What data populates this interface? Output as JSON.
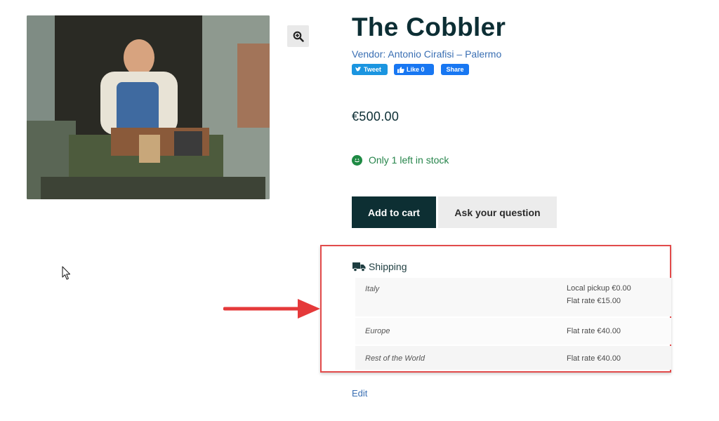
{
  "product": {
    "title": "The Cobbler",
    "vendor": "Vendor: Antonio Cirafisi – Palermo",
    "price": "€500.00",
    "stock": "Only 1 left in stock",
    "image_icon": "cobbler-painting"
  },
  "social": {
    "tweet_label": "Tweet",
    "like_label": "Like 0",
    "share_label": "Share"
  },
  "actions": {
    "add_to_cart": "Add to cart",
    "ask_question": "Ask your question"
  },
  "shipping": {
    "header": "Shipping",
    "rows": [
      {
        "region": "Italy",
        "methods": [
          "Local pickup €0.00",
          "Flat rate €15.00"
        ]
      },
      {
        "region": "Europe",
        "methods": [
          "Flat rate €40.00"
        ]
      },
      {
        "region": "Rest of the World",
        "methods": [
          "Flat rate €40.00"
        ]
      }
    ]
  },
  "edit_label": "Edit",
  "colors": {
    "title": "#0c2e34",
    "link": "#3a6fb3",
    "stock": "#25844a",
    "primary_button": "#0d2f33",
    "highlight_border": "#e24b4b",
    "annotation_arrow": "#e5393a"
  }
}
